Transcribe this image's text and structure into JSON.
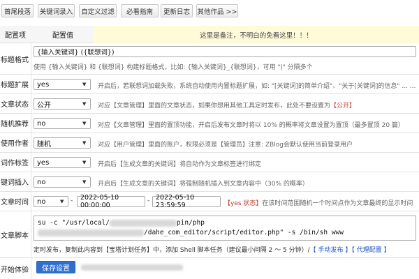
{
  "nav": [
    "首尾段落",
    "关键词录入",
    "自定义过滤",
    "必看指南",
    "更新日志",
    "其他作品 >>"
  ],
  "header": {
    "col1": "配置项",
    "col2": "配置值",
    "note": "这里是备注，不明白的免看这里！！！"
  },
  "title_format": {
    "label": "标题格式",
    "value": "{输入关键词} ({联想词})",
    "desc": "使用 {输入关键词} 和 {联想词} 构建标题格式，比如: {输入关键词}_{联想词}，可用 \"|\" 分隔多个"
  },
  "title_expand": {
    "label": "标题扩展",
    "value": "yes",
    "desc": "开启后，若联想词加载失败，系统自动使用内置标题扩展，如: \"[关键词]的简单介绍\"、\"关于[关键词]的信息\" ... ..."
  },
  "article_status": {
    "label": "文章状态",
    "value": "公开",
    "desc_pre": "对应【文章管理】里面的文章状态，如果你想用其他工具定时发布，此处不要设置为",
    "desc_red": "【公开】"
  },
  "random_recommend": {
    "label": "随机推荐",
    "value": "no",
    "desc": "对应【文章管理】里面的置顶功能，开启后发布文章时将以 10% 的概率将文章设置为置顶（最多置顶 20 篇）"
  },
  "author": {
    "label": "使用作者",
    "value": "随机",
    "desc": "对应【用户管理】里面的账户，权限必须是【管理员】注意: ZBlog会默认使用当前登录用户"
  },
  "keyword_tag": {
    "label": "词作标签",
    "value": "yes",
    "desc": "开启后【生成文章的关键词】将自动作为文章标签进行绑定"
  },
  "keyword_insert": {
    "label": "键词插入",
    "value": "no",
    "desc": "开启后【生成文章的关键词】将强制随机插入到文章内容中（30% 的概率）"
  },
  "article_time": {
    "label": "文章时间",
    "value": "no",
    "dash": "-",
    "start": "2022-05-10 00:00:00",
    "end": "2022-05-10 23:59:59",
    "desc_red": "【yes 状态】",
    "desc": "在该时间范围随机一个时间点作为文章最终的显示时间"
  },
  "article_script": {
    "label": "文章脚本",
    "code_line1_a": "su -c \"/usr/local/",
    "code_line1_b": "pin/php",
    "code_line2_b": "/dahe_com_editor/script/editor.php\" -s /bin/sh www",
    "desc_pre": "定时发布，复制此内容到【宝塔计划任务】中，添加 Shell 脚本任务（建议最小间隔 2 ～ 5 分钟）/",
    "link1": "【 手动发布 】",
    "link2": "【 代理配置 】"
  },
  "start_exp": {
    "label": "开始体验",
    "button": "保存设置"
  }
}
